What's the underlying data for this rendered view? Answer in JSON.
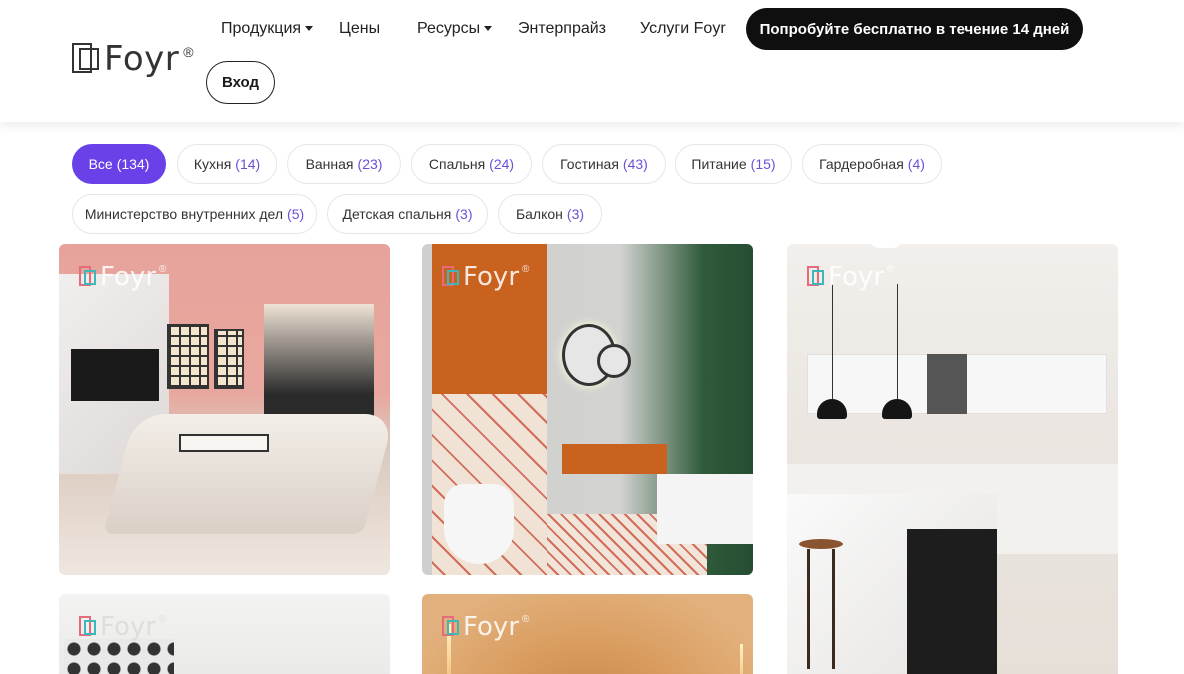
{
  "header": {
    "logo_text": "Foyr",
    "logo_reg": "®",
    "nav": [
      {
        "label": "Продукция",
        "has_dropdown": true
      },
      {
        "label": "Цены",
        "has_dropdown": false
      },
      {
        "label": "Ресурсы",
        "has_dropdown": true
      },
      {
        "label": "Энтерпрайз",
        "has_dropdown": false
      },
      {
        "label": "Услуги Foyr",
        "has_dropdown": false
      }
    ],
    "cta_label": "Попробуйте бесплатно в течение 14 дней",
    "login_label": "Вход"
  },
  "filters": [
    {
      "label": "Все",
      "count": "(134)",
      "active": true
    },
    {
      "label": "Кухня",
      "count": "(14)",
      "active": false
    },
    {
      "label": "Ванная",
      "count": "(23)",
      "active": false
    },
    {
      "label": "Спальня",
      "count": "(24)",
      "active": false
    },
    {
      "label": "Гостиная",
      "count": "(43)",
      "active": false
    },
    {
      "label": "Питание",
      "count": "(15)",
      "active": false
    },
    {
      "label": "Гардеробная",
      "count": "(4)",
      "active": false
    },
    {
      "label": "Министерство внутренних дел",
      "count": "(5)",
      "active": false
    },
    {
      "label": "Детская спальня",
      "count": "(3)",
      "active": false
    },
    {
      "label": "Балкон",
      "count": "(3)",
      "active": false
    }
  ],
  "gallery": {
    "watermark_text": "Foyr",
    "watermark_reg": "®"
  },
  "colors": {
    "accent": "#6a41e8",
    "count": "#6e4fd8",
    "cta_bg": "#0f0f0f"
  }
}
